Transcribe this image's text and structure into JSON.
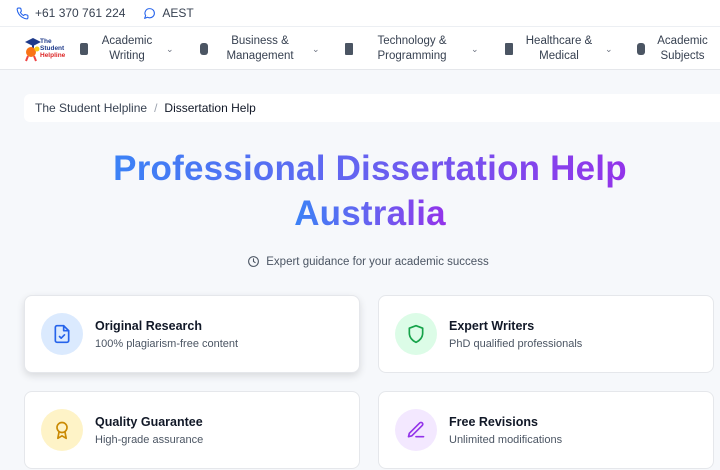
{
  "contact": {
    "phone": "+61 370 761 224",
    "timezone": "AEST"
  },
  "logo": {
    "line1": "The Student",
    "line2": "Helpline"
  },
  "nav": {
    "items": [
      {
        "line1": "Academic",
        "line2": "Writing"
      },
      {
        "line1": "Business &",
        "line2": "Management"
      },
      {
        "line1": "Technology &",
        "line2": "Programming"
      },
      {
        "line1": "Healthcare &",
        "line2": "Medical"
      },
      {
        "line1": "Academic",
        "line2": "Subjects"
      }
    ]
  },
  "breadcrumb": {
    "home": "The Student Helpline",
    "separator": "/",
    "current": "Dissertation Help"
  },
  "hero": {
    "title_line1": "Professional Dissertation Help",
    "title_line2": "Australia",
    "subtitle": "Expert guidance for your academic success"
  },
  "features": [
    {
      "title": "Original Research",
      "desc": "100% plagiarism-free content",
      "icon": "document-check-icon",
      "icon_bg": "#dbeafe",
      "icon_color": "#2563eb"
    },
    {
      "title": "Expert Writers",
      "desc": "PhD qualified professionals",
      "icon": "shield-icon",
      "icon_bg": "#dcfce7",
      "icon_color": "#16a34a"
    },
    {
      "title": "Quality Guarantee",
      "desc": "High-grade assurance",
      "icon": "award-icon",
      "icon_bg": "#fef3c7",
      "icon_color": "#ca8a04"
    },
    {
      "title": "Free Revisions",
      "desc": "Unlimited modifications",
      "icon": "pen-icon",
      "icon_bg": "#f3e8ff",
      "icon_color": "#9333ea"
    }
  ],
  "colors": {
    "gradient_start": "#3b82f6",
    "gradient_end": "#9333ea"
  }
}
